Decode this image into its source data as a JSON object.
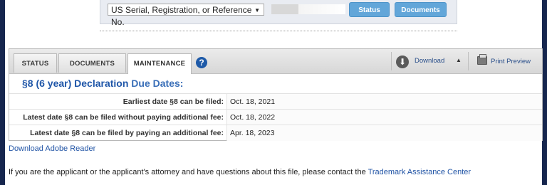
{
  "search": {
    "type_selected": "US Serial, Registration, or Reference No.",
    "query_value": "",
    "status_button": "Status",
    "documents_button": "Documents"
  },
  "tabs": [
    {
      "label": "STATUS",
      "active": false
    },
    {
      "label": "DOCUMENTS",
      "active": false
    },
    {
      "label": "MAINTENANCE",
      "active": true
    }
  ],
  "toolbar": {
    "help_glyph": "?",
    "download_label": "Download",
    "print_label": "Print Preview"
  },
  "section": {
    "title_part1": "§8 (6 year) Declaration",
    "title_part2": "Due Dates:"
  },
  "rows": [
    {
      "label": "Earliest date §8 can be filed:",
      "value": "Oct. 18, 2021"
    },
    {
      "label": "Latest date §8 can be filed without paying additional fee:",
      "value": "Oct. 18, 2022"
    },
    {
      "label": "Latest date §8 can be filed by paying an additional fee:",
      "value": "Apr. 18, 2023"
    }
  ],
  "links": {
    "adobe": "Download Adobe Reader"
  },
  "footer": {
    "text": "If you are the applicant or the applicant's attorney and have questions about this file, please contact the ",
    "link": "Trademark Assistance Center"
  },
  "colors": {
    "accent_blue": "#1f56a8",
    "button_blue": "#62a6d9",
    "side_bar": "#16264e"
  },
  "icons": [
    "select-caret-icon",
    "help-icon",
    "download-icon",
    "caret-up-icon",
    "printer-icon"
  ]
}
